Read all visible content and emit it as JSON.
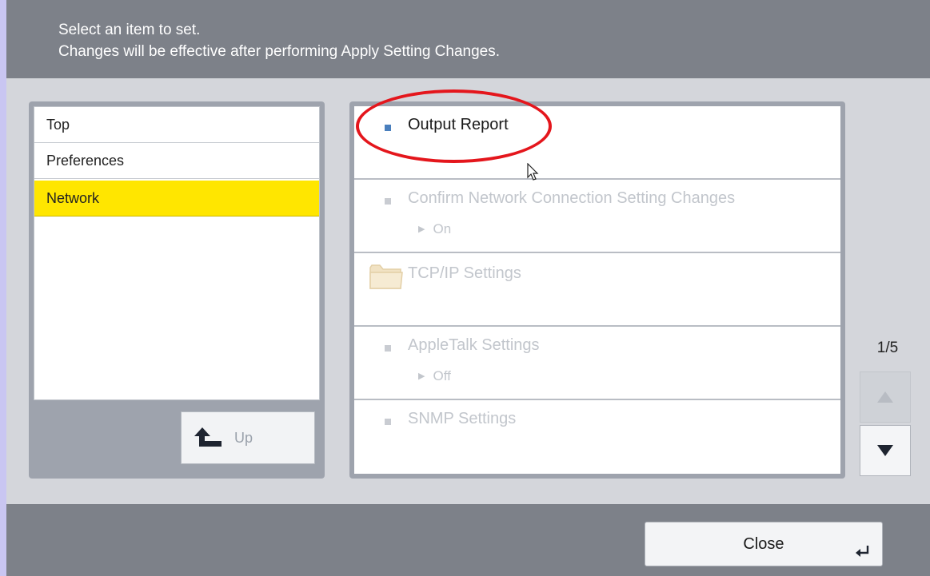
{
  "header": {
    "line1": "Select an item to set.",
    "line2": "Changes will be effective after performing Apply Setting Changes."
  },
  "nav": {
    "items": [
      {
        "label": "Top",
        "selected": false
      },
      {
        "label": "Preferences",
        "selected": false
      },
      {
        "label": "Network",
        "selected": true
      }
    ],
    "up_label": "Up"
  },
  "settings": {
    "items": [
      {
        "title": "Output Report",
        "value": "",
        "enabled": true,
        "icon": "bullet-square-icon"
      },
      {
        "title": "Confirm Network Connection Setting Changes",
        "value": "On",
        "enabled": false,
        "icon": "bullet-square-icon"
      },
      {
        "title": "TCP/IP Settings",
        "value": "",
        "enabled": false,
        "icon": "folder-icon"
      },
      {
        "title": "AppleTalk Settings",
        "value": "Off",
        "enabled": false,
        "icon": "bullet-square-icon"
      },
      {
        "title": "SNMP Settings",
        "value": "",
        "enabled": false,
        "icon": "bullet-square-icon"
      }
    ]
  },
  "pagination": {
    "indicator": "1/5"
  },
  "footer": {
    "close_label": "Close"
  },
  "colors": {
    "selected_nav": "#ffe600",
    "highlight_annotation": "#e4161c",
    "header_bar": "#7d8189",
    "active_bullet": "#4a7fbd"
  }
}
